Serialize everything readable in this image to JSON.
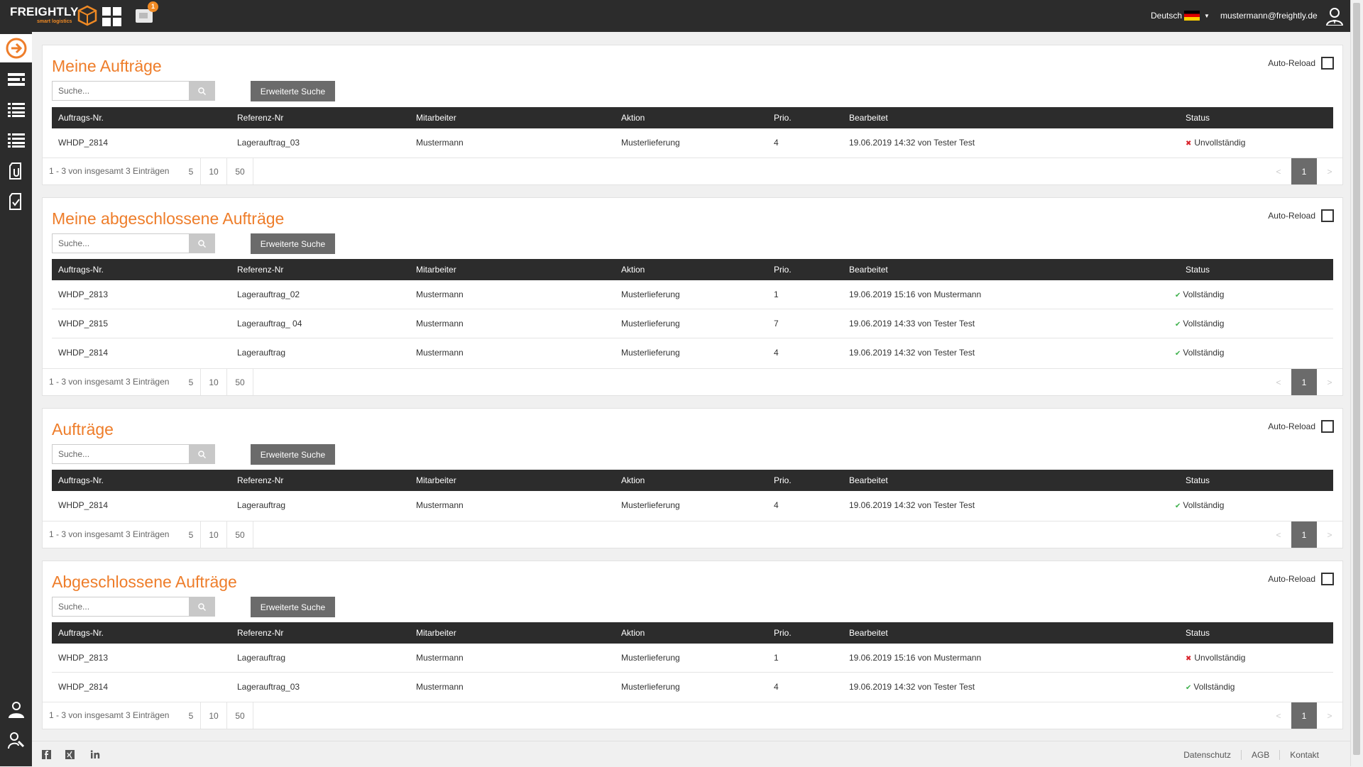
{
  "brand": {
    "name": "FREIGHTLY",
    "tagline": "smart logistics"
  },
  "header": {
    "notification_count": "1",
    "language": "Deutsch",
    "user_email": "mustermann@freightly.de"
  },
  "sidebar": {
    "top_items": [
      "arrow-right-circle-icon",
      "truck-list-icon",
      "list-icon",
      "list-alt-icon",
      "document-clip-icon",
      "document-check-icon"
    ],
    "bottom_items": [
      "user-settings-icon",
      "user-tools-icon"
    ]
  },
  "common": {
    "search_placeholder": "Suche...",
    "advanced_search": "Erweiterte Suche",
    "auto_reload": "Auto-Reload",
    "columns": [
      "Auftrags-Nr.",
      "Referenz-Nr",
      "Mitarbeiter",
      "Aktion",
      "Prio.",
      "Bearbeitet",
      "Status"
    ],
    "page_sizes": [
      "5",
      "10",
      "50"
    ],
    "prev": "<",
    "next": ">",
    "current_page": "1"
  },
  "panels": [
    {
      "title": "Meine Aufträge",
      "info": "1 - 3 von insgesamt 3 Einträgen",
      "rows": [
        {
          "id": "WHDP_2814",
          "ref": "Lagerauftrag_03",
          "emp": "Mustermann",
          "action": "Musterlieferung",
          "prio": "4",
          "edited": "19.06.2019 14:32 von Tester Test",
          "status": "Unvollständig",
          "ok": false
        }
      ]
    },
    {
      "title": "Meine abgeschlossene Aufträge",
      "info": "1 - 3 von insgesamt 3 Einträgen",
      "rows": [
        {
          "id": "WHDP_2813",
          "ref": "Lagerauftrag_02",
          "emp": "Mustermann",
          "action": "Musterlieferung",
          "prio": "1",
          "edited": "19.06.2019 15:16 von  Mustermann",
          "status": "Vollständig",
          "ok": true
        },
        {
          "id": "WHDP_2815",
          "ref": "Lagerauftrag_ 04",
          "emp": "Mustermann",
          "action": "Musterlieferung",
          "prio": "7",
          "edited": "19.06.2019 14:33 von Tester Test",
          "status": "Vollständig",
          "ok": true
        },
        {
          "id": "WHDP_2814",
          "ref": "Lagerauftrag",
          "emp": "Mustermann",
          "action": "Musterlieferung",
          "prio": "4",
          "edited": "19.06.2019 14:32 von Tester Test",
          "status": "Vollständig",
          "ok": true
        }
      ]
    },
    {
      "title": "Aufträge",
      "info": "1 - 3 von insgesamt 3 Einträgen",
      "rows": [
        {
          "id": "WHDP_2814",
          "ref": "Lagerauftrag",
          "emp": "Mustermann",
          "action": "Musterlieferung",
          "prio": "4",
          "edited": "19.06.2019 14:32 von Tester Test",
          "status": "Vollständig",
          "ok": true
        }
      ]
    },
    {
      "title": "Abgeschlossene Aufträge",
      "info": "1 - 3 von insgesamt 3 Einträgen",
      "rows": [
        {
          "id": "WHDP_2813",
          "ref": "Lagerauftrag",
          "emp": "Mustermann",
          "action": "Musterlieferung",
          "prio": "1",
          "edited": "19.06.2019 15:16 von Mustermann",
          "status": "Unvollständig",
          "ok": false
        },
        {
          "id": "WHDP_2814",
          "ref": "Lagerauftrag_03",
          "emp": "Mustermann",
          "action": "Musterlieferung",
          "prio": "4",
          "edited": "19.06.2019 14:32 von Tester Test",
          "status": "Vollständig",
          "ok": true
        }
      ]
    }
  ],
  "footer": {
    "social": [
      "facebook-icon",
      "xing-icon",
      "linkedin-icon"
    ],
    "links": [
      "Datenschutz",
      "AGB",
      "Kontakt"
    ]
  },
  "colors": {
    "accent": "#ee7d2a",
    "dark": "#2c2c2c",
    "ok": "#3cb04a",
    "error": "#d9242c"
  }
}
